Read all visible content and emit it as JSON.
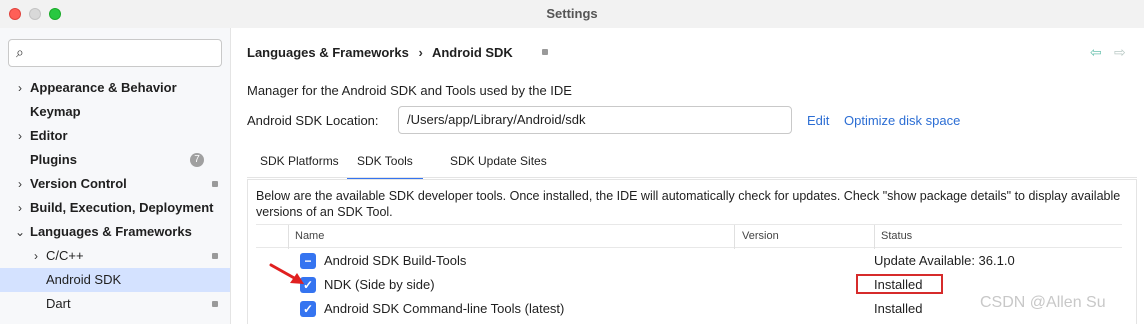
{
  "window": {
    "title": "Settings"
  },
  "sidebar": {
    "search_placeholder": "",
    "items": [
      {
        "label": "Appearance & Behavior",
        "expandable": true
      },
      {
        "label": "Keymap",
        "expandable": false
      },
      {
        "label": "Editor",
        "expandable": true
      },
      {
        "label": "Plugins",
        "expandable": false,
        "badge": "7"
      },
      {
        "label": "Version Control",
        "expandable": true
      },
      {
        "label": "Build, Execution, Deployment",
        "expandable": true
      },
      {
        "label": "Languages & Frameworks",
        "expandable": true,
        "expanded": true
      },
      {
        "label": "C/C++",
        "expandable": true
      },
      {
        "label": "Android SDK",
        "selected": true
      },
      {
        "label": "Dart"
      }
    ]
  },
  "header": {
    "breadcrumb": [
      "Languages & Frameworks",
      "Android SDK"
    ],
    "separator": "›"
  },
  "main": {
    "description": "Manager for the Android SDK and Tools used by the IDE",
    "location_label": "Android SDK Location:",
    "location_value": "/Users/app/Library/Android/sdk",
    "edit_link": "Edit",
    "optimize_link": "Optimize disk space",
    "tabs": [
      {
        "label": "SDK Platforms",
        "active": false
      },
      {
        "label": "SDK Tools",
        "active": true
      },
      {
        "label": "SDK Update Sites",
        "active": false
      }
    ],
    "panel_description": "Below are the available SDK developer tools. Once installed, the IDE will automatically check for updates. Check \"show package details\" to display available versions of an SDK Tool.",
    "table": {
      "columns": [
        "Name",
        "Version",
        "Status"
      ],
      "rows": [
        {
          "name": "Android SDK Build-Tools",
          "version": "",
          "status": "Update Available: 36.1.0",
          "checkbox": "partial"
        },
        {
          "name": "NDK (Side by side)",
          "version": "",
          "status": "Installed",
          "checkbox": "checked",
          "highlighted": true
        },
        {
          "name": "Android SDK Command-line Tools (latest)",
          "version": "",
          "status": "Installed",
          "checkbox": "checked"
        }
      ]
    }
  },
  "watermark": "CSDN @Allen Su",
  "colors": {
    "accent": "#3574f0",
    "link": "#2c6ed4",
    "highlight": "#d62b2b",
    "annotation_arrow": "#e02020"
  }
}
